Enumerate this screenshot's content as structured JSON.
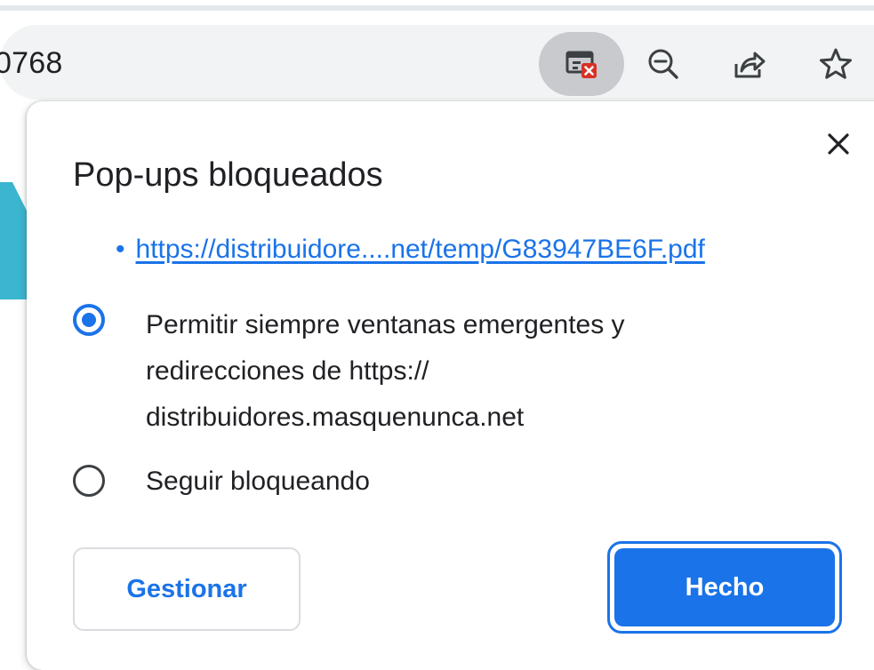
{
  "omnibox": {
    "url_fragment": "0768"
  },
  "toolbar": {
    "popup_blocked_icon": "popup-blocked-icon",
    "zoom_icon": "zoom-out-icon",
    "share_icon": "share-icon",
    "bookmark_icon": "star-icon"
  },
  "dialog": {
    "title": "Pop-ups bloqueados",
    "close_icon": "close-icon",
    "blocked_url": "https://distribuidore....net/temp/G83947BE6F.pdf",
    "options": [
      {
        "label": "Permitir siempre ventanas emergentes y redirecciones de https:// distribuidores.masquenunca.net",
        "selected": true
      },
      {
        "label": "Seguir bloqueando",
        "selected": false
      }
    ],
    "manage_label": "Gestionar",
    "done_label": "Hecho"
  },
  "colors": {
    "accent": "#1a73e8",
    "text": "#202124",
    "omnibox_bg": "#f1f3f4",
    "page_graphic": "#3bb5d0"
  }
}
